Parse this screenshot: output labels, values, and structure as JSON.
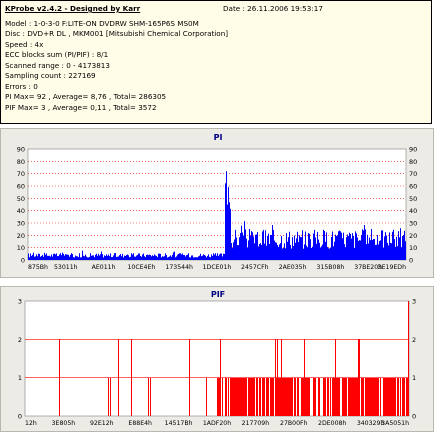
{
  "header": {
    "title": "KProbe v2.4.2 - Designed by Karr",
    "date": "Date : 26.11.2006 19:53:17",
    "lines": [
      "Model : 1-0-3-0 F:LITE-ON DVDRW SHM-165P6S MS0M",
      "Disc : DVD+R DL , MKM001 [Mitsubishi Chemical Corporation]",
      "Speed : 4x",
      "ECC blocks sum (PI/PIF) : 8/1",
      "Scanned range : 0 - 4173813",
      "Sampling count : 227169",
      "Errors : 0",
      "PI Max= 92 , Average= 8,76 , Total= 286305",
      "PIF Max= 3 , Average= 0,11 , Total= 3572"
    ]
  },
  "colors": {
    "bars": "#0000ff",
    "pif_bars": "#ff0000",
    "grid": "#ff0000",
    "panel": "#ecebe5"
  },
  "chart_data": [
    {
      "type": "bar",
      "title": "PI",
      "ylim": [
        0,
        90
      ],
      "yticks": [
        "90",
        "80",
        "70",
        "60",
        "50",
        "40",
        "30",
        "20",
        "10",
        "0"
      ],
      "xticks": [
        "875Bh",
        "53011h",
        "AE011h",
        "10CE4Eh",
        "173544h",
        "1DCE01h",
        "2457CFh",
        "2AE035h",
        "315B08h",
        "37BE20h",
        "3E19EDh"
      ],
      "segments": [
        {
          "x_from": 0.0,
          "x_to": 0.52,
          "typical": 4,
          "max": 9
        },
        {
          "x_from": 0.52,
          "x_to": 0.535,
          "typical": 45,
          "max": 92
        },
        {
          "x_from": 0.535,
          "x_to": 1.0,
          "typical": 18,
          "max": 32
        }
      ]
    },
    {
      "type": "bar",
      "title": "PIF",
      "ylim": [
        0,
        3
      ],
      "yticks": [
        "3",
        "2",
        "1",
        "0"
      ],
      "xticks": [
        "12h",
        "3E805h",
        "92E12h",
        "E88E4h",
        "14517Bh",
        "1ADF20h",
        "217709h",
        "27B00Fh",
        "2DE008h",
        "340329h",
        "3A5051h"
      ],
      "segments": [
        {
          "x_from": 0.0,
          "x_to": 0.5,
          "typical": 0,
          "max": 2
        },
        {
          "x_from": 0.5,
          "x_to": 1.0,
          "typical": 1,
          "max": 3
        }
      ]
    }
  ]
}
